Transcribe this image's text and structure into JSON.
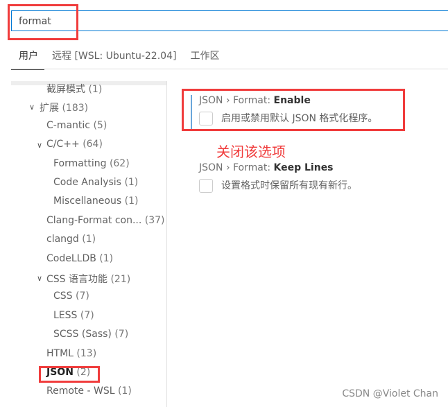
{
  "search": {
    "value": "format"
  },
  "tabs": [
    {
      "label": "用户"
    },
    {
      "label": "远程 [WSL: Ubuntu-22.04]"
    },
    {
      "label": "工作区"
    }
  ],
  "tree": [
    {
      "label": "截屏模式",
      "count": "(1)"
    },
    {
      "label": "扩展",
      "count": "(183)"
    },
    {
      "label": "C-mantic",
      "count": "(5)"
    },
    {
      "label": "C/C++",
      "count": "(64)"
    },
    {
      "label": "Formatting",
      "count": "(62)"
    },
    {
      "label": "Code Analysis",
      "count": "(1)"
    },
    {
      "label": "Miscellaneous",
      "count": "(1)"
    },
    {
      "label": "Clang-Format con...",
      "count": "(37)"
    },
    {
      "label": "clangd",
      "count": "(1)"
    },
    {
      "label": "CodeLLDB",
      "count": "(1)"
    },
    {
      "label": "CSS 语言功能",
      "count": "(21)"
    },
    {
      "label": "CSS",
      "count": "(7)"
    },
    {
      "label": "LESS",
      "count": "(7)"
    },
    {
      "label": "SCSS (Sass)",
      "count": "(7)"
    },
    {
      "label": "HTML",
      "count": "(13)"
    },
    {
      "label": "JSON",
      "count": "(2)"
    },
    {
      "label": "Remote - WSL",
      "count": "(1)"
    }
  ],
  "settings": [
    {
      "prefix": "JSON › Format: ",
      "name": "Enable",
      "description": "启用或禁用默认 JSON 格式化程序。",
      "checked": false
    },
    {
      "prefix": "JSON › Format: ",
      "name": "Keep Lines",
      "description": "设置格式时保留所有现有新行。",
      "checked": false
    }
  ],
  "annotation": "关闭该选项",
  "watermark": "CSDN @Violet Chan",
  "colors": {
    "highlight": "#f03c3c",
    "focus": "#0078d4"
  }
}
